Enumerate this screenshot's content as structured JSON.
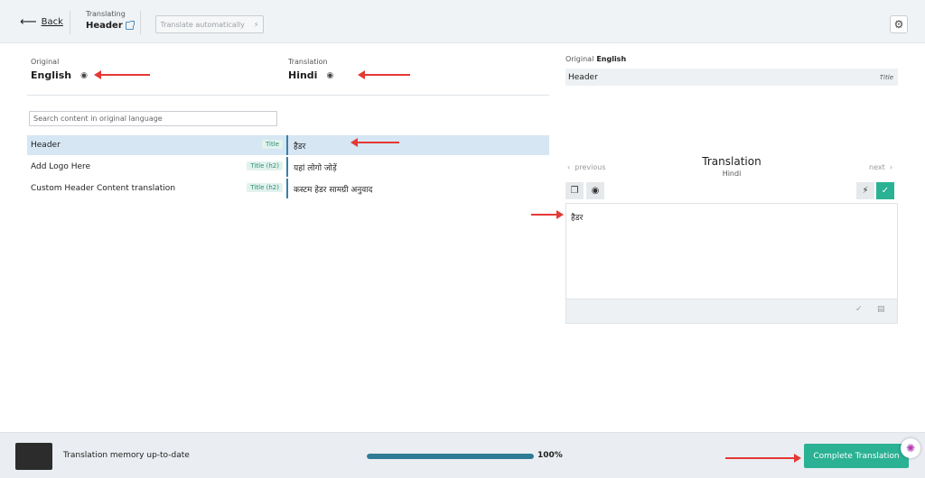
{
  "header": {
    "back_label": "Back",
    "translating_label": "Translating",
    "item_name": "Header",
    "auto_translate_label": "Translate automatically"
  },
  "languages": {
    "original_label": "Original",
    "original_value": "English",
    "translation_label": "Translation",
    "translation_value": "Hindi"
  },
  "search": {
    "placeholder": "Search content in original language"
  },
  "rows": [
    {
      "original": "Header",
      "badge": "Title",
      "translation": "हैडर"
    },
    {
      "original": "Add Logo Here",
      "badge": "Title (h2)",
      "translation": "यहां लोगो जोड़ें"
    },
    {
      "original": "Custom Header Content translation",
      "badge": "Title (h2)",
      "translation": "कस्टम हेडर सामग्री अनुवाद"
    }
  ],
  "right_panel": {
    "original_label": "Original",
    "original_lang": "English",
    "original_text": "Header",
    "original_tag": "Title",
    "translation_title": "Translation",
    "translation_lang": "Hindi",
    "previous_label": "previous",
    "next_label": "next",
    "editor_text": "हैडर"
  },
  "footer": {
    "memory_status": "Translation memory up-to-date",
    "progress_percent": 100,
    "progress_label": "100%",
    "complete_button": "Complete Translation"
  },
  "icons": [
    "back-arrow-icon",
    "external-link-icon",
    "lightning-icon",
    "gear-icon",
    "eye-off-icon",
    "chevron-left-icon",
    "chevron-right-icon",
    "copy-icon",
    "check-icon",
    "spellcheck-icon",
    "glossary-icon",
    "brain-icon"
  ],
  "colors": {
    "accent_green": "#2bb193",
    "selected_row": "#d6e6f3",
    "progress": "#2f7a94",
    "annotation": "#e53935"
  }
}
